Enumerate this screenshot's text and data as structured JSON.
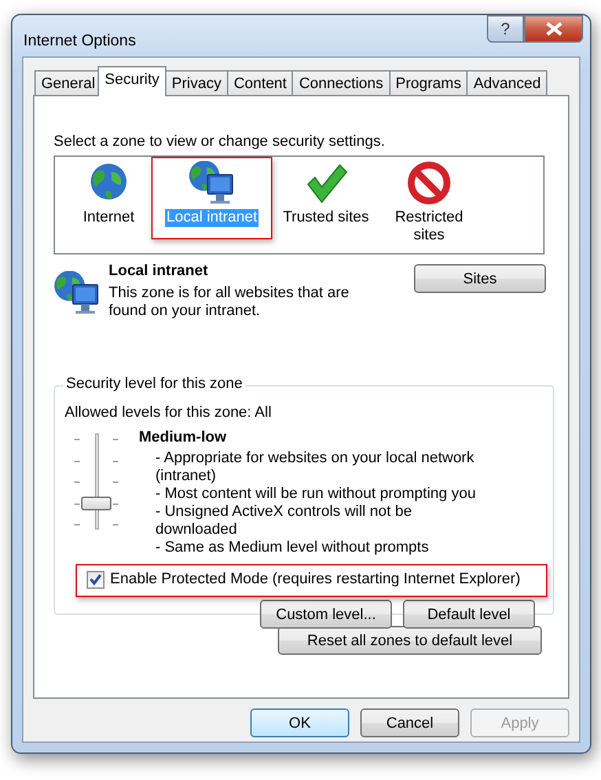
{
  "window": {
    "title": "Internet Options",
    "help": "?"
  },
  "tabs": [
    {
      "label": "General",
      "selected": false
    },
    {
      "label": "Security",
      "selected": true
    },
    {
      "label": "Privacy",
      "selected": false
    },
    {
      "label": "Content",
      "selected": false
    },
    {
      "label": "Connections",
      "selected": false
    },
    {
      "label": "Programs",
      "selected": false
    },
    {
      "label": "Advanced",
      "selected": false
    }
  ],
  "zone_prompt": "Select a zone to view or change security settings.",
  "zones": [
    {
      "label": "Internet",
      "kind": "globe",
      "selected": false,
      "highlighted": false
    },
    {
      "label": "Local intranet",
      "kind": "intranet",
      "selected": true,
      "highlighted": true
    },
    {
      "label": "Trusted sites",
      "kind": "check",
      "selected": false,
      "highlighted": false
    },
    {
      "label": "Restricted sites",
      "kind": "blocked",
      "selected": false,
      "highlighted": false
    }
  ],
  "zone_info": {
    "title": "Local intranet",
    "description": "This zone is for all websites that are found on your intranet.",
    "button": "Sites"
  },
  "security_level": {
    "group_title": "Security level for this zone",
    "allowed": "Allowed levels for this zone: All",
    "level": 0.25,
    "level_name": "Medium-low",
    "bullets": [
      "- Appropriate for websites on your local network (intranet)",
      "- Most content will be run without prompting you",
      "- Unsigned ActiveX controls will not be downloaded",
      "- Same as Medium level without prompts"
    ],
    "protected_mode": {
      "label": "Enable Protected Mode (requires restarting Internet Explorer)",
      "checked": true,
      "highlighted": true
    },
    "buttons": [
      "Custom level...",
      "Default level"
    ]
  },
  "reset_button": "Reset all zones to default level",
  "footer_buttons": [
    {
      "label": "OK",
      "default": true,
      "disabled": false
    },
    {
      "label": "Cancel",
      "default": false,
      "disabled": false
    },
    {
      "label": "Apply",
      "default": false,
      "disabled": true
    }
  ]
}
